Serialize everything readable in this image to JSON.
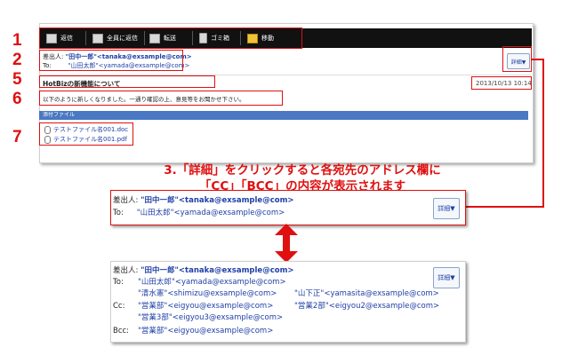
{
  "markers": {
    "n1": "1",
    "n2": "2",
    "n3": "3",
    "n4": "4",
    "n5": "5",
    "n6": "6",
    "n7": "7"
  },
  "toolbar": {
    "buttons": [
      {
        "label": "返信",
        "icon": "reply-icon"
      },
      {
        "label": "全員に返信",
        "icon": "reply-all-icon"
      },
      {
        "label": "転送",
        "icon": "forward-icon"
      },
      {
        "label": "ゴミ箱",
        "icon": "trash-icon"
      },
      {
        "label": "移動",
        "icon": "folder-icon"
      }
    ]
  },
  "header": {
    "from_label": "差出人:",
    "from_value": "\"田中一郎\"<tanaka@exsample@com>",
    "to_label": "To:",
    "to_value": "\"山田太郎\"<yamada@exsample@com>",
    "detail_button": "詳細▼"
  },
  "mail": {
    "subject": "HotBizの新機能について",
    "date": "2013/10/13 10:14",
    "body": "以下のように新しくなりました。一通り確認の上、意見等をお聞かせ下さい。",
    "attach_header": "添付ファイル",
    "attachments": [
      "テストファイル名001.doc",
      "テストファイル名001.pdf"
    ]
  },
  "caption": {
    "line1": "3.「詳細」をクリックすると各宛先のアドレス欄に",
    "line2": "「CC」「BCC」の内容が表示されます"
  },
  "collapsed": {
    "from_label": "差出人:",
    "from_value": "\"田中一郎\"<tanaka@exsample@com>",
    "to_label": "To:",
    "to_value": "\"山田太郎\"<yamada@exsample@com>",
    "detail_button": "詳細▼"
  },
  "expanded": {
    "from_label": "差出人:",
    "from_value": "\"田中一郎\"<tanaka@exsample@com>",
    "to_label": "To:",
    "to_1": "\"山田太郎\"<yamada@exsample@com>",
    "to_2": "\"清水憲\"<shimizu@exsample@com>",
    "to_3": "\"山下正\"<yamasita@exsample@com>",
    "cc_label": "Cc:",
    "cc_1": "\"営業部\"<eigyou@exsample@com>",
    "cc_2": "\"営業2部\"<eigyou2@exsample@com>",
    "cc_3": "\"営業3部\"<eigyou3@exsample@com>",
    "bcc_label": "Bcc:",
    "bcc_1": "\"営業部\"<eigyou@exsample@com>",
    "detail_button": "詳細▼"
  },
  "colors": {
    "accent": "#e01010",
    "link": "#1f3fa6",
    "attach_bar": "#4a78c2"
  }
}
